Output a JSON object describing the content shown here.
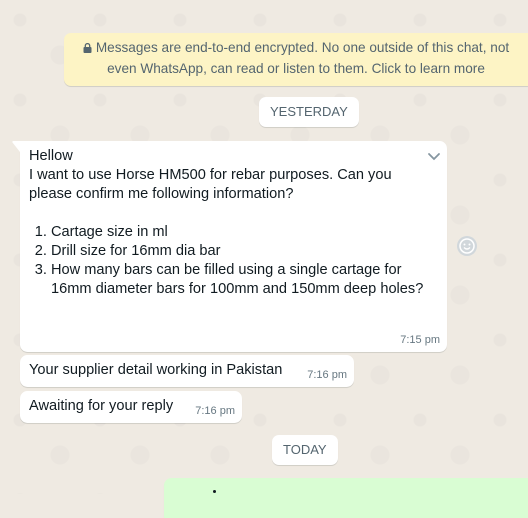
{
  "encryption_notice": {
    "line1": "Messages are end-to-end encrypted. No one outside of this chat, not",
    "line2": "even WhatsApp, can read or listen to them. Click to learn more",
    "icon": "lock-icon"
  },
  "day_separators": {
    "yesterday": "YESTERDAY",
    "today": "TODAY"
  },
  "messages": [
    {
      "lines": [
        "Hellow",
        "I want to use Horse HM500 for rebar purposes. Can you",
        "please confirm me following information?"
      ],
      "list": [
        "Cartage size in ml",
        "Drill size for 16mm dia bar",
        "How many bars can be filled using a single cartage for 16mm diameter bars for 100mm and 150mm deep holes?"
      ],
      "time": "7:15 pm"
    },
    {
      "text": "Your supplier detail working in Pakistan",
      "time": "7:16 pm"
    },
    {
      "text": "Awaiting for your reply",
      "time": "7:16 pm"
    }
  ],
  "icons": {
    "menu": "chevron-down-icon",
    "react": "emoji-icon"
  },
  "colors": {
    "background": "#efeae2",
    "incoming_bubble": "#ffffff",
    "outgoing_bubble": "#d9fdd3",
    "notice_bg": "#fdf4c5"
  }
}
